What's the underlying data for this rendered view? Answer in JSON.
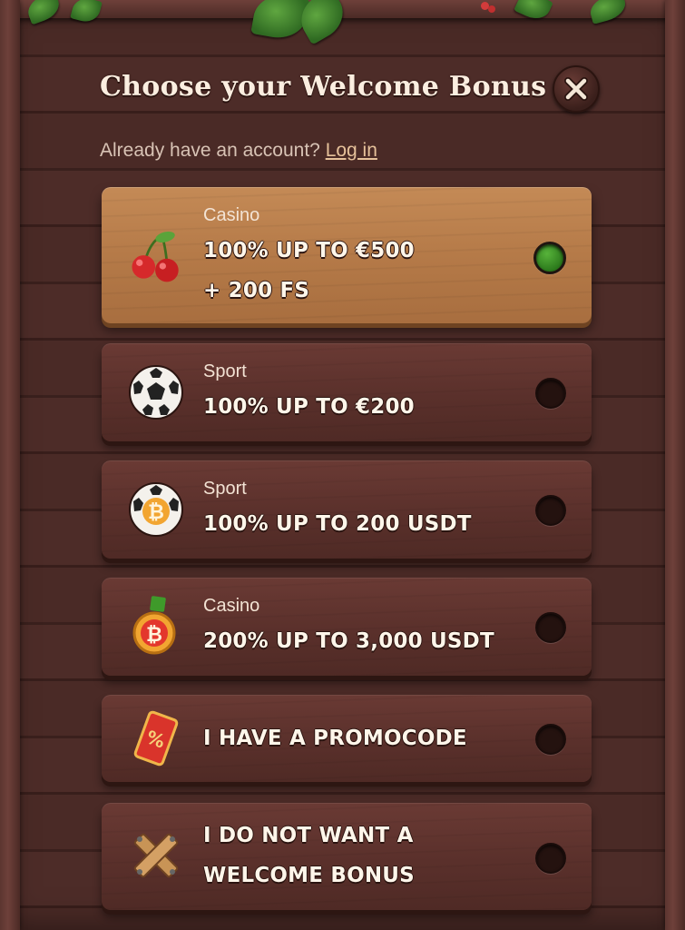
{
  "modal": {
    "title": "Choose your Welcome Bonus",
    "login_prompt": "Already have an account?",
    "login_link": "Log in"
  },
  "options": [
    {
      "category": "Casino",
      "line1": "100% UP TO €500",
      "line2": "+ 200 FS",
      "icon": "cherries-icon",
      "selected": true
    },
    {
      "category": "Sport",
      "line1": "100% UP TO €200",
      "line2": "",
      "icon": "soccer-ball-icon",
      "selected": false
    },
    {
      "category": "Sport",
      "line1": "100% UP TO 200 USDT",
      "line2": "",
      "icon": "bitcoin-ball-icon",
      "selected": false
    },
    {
      "category": "Casino",
      "line1": "200% UP TO 3,000 USDT",
      "line2": "",
      "icon": "bitcoin-medal-icon",
      "selected": false
    },
    {
      "category": "",
      "line1": "I HAVE A PROMOCODE",
      "line2": "",
      "icon": "promo-ticket-icon",
      "selected": false
    },
    {
      "category": "",
      "line1": "I DO NOT WANT A",
      "line2": "WELCOME BONUS",
      "icon": "crossed-planks-icon",
      "selected": false
    }
  ],
  "colors": {
    "selected_card": "#b57a48",
    "card": "#5a302b",
    "radio_on": "#3f9a2a",
    "link": "#e6c19a"
  }
}
